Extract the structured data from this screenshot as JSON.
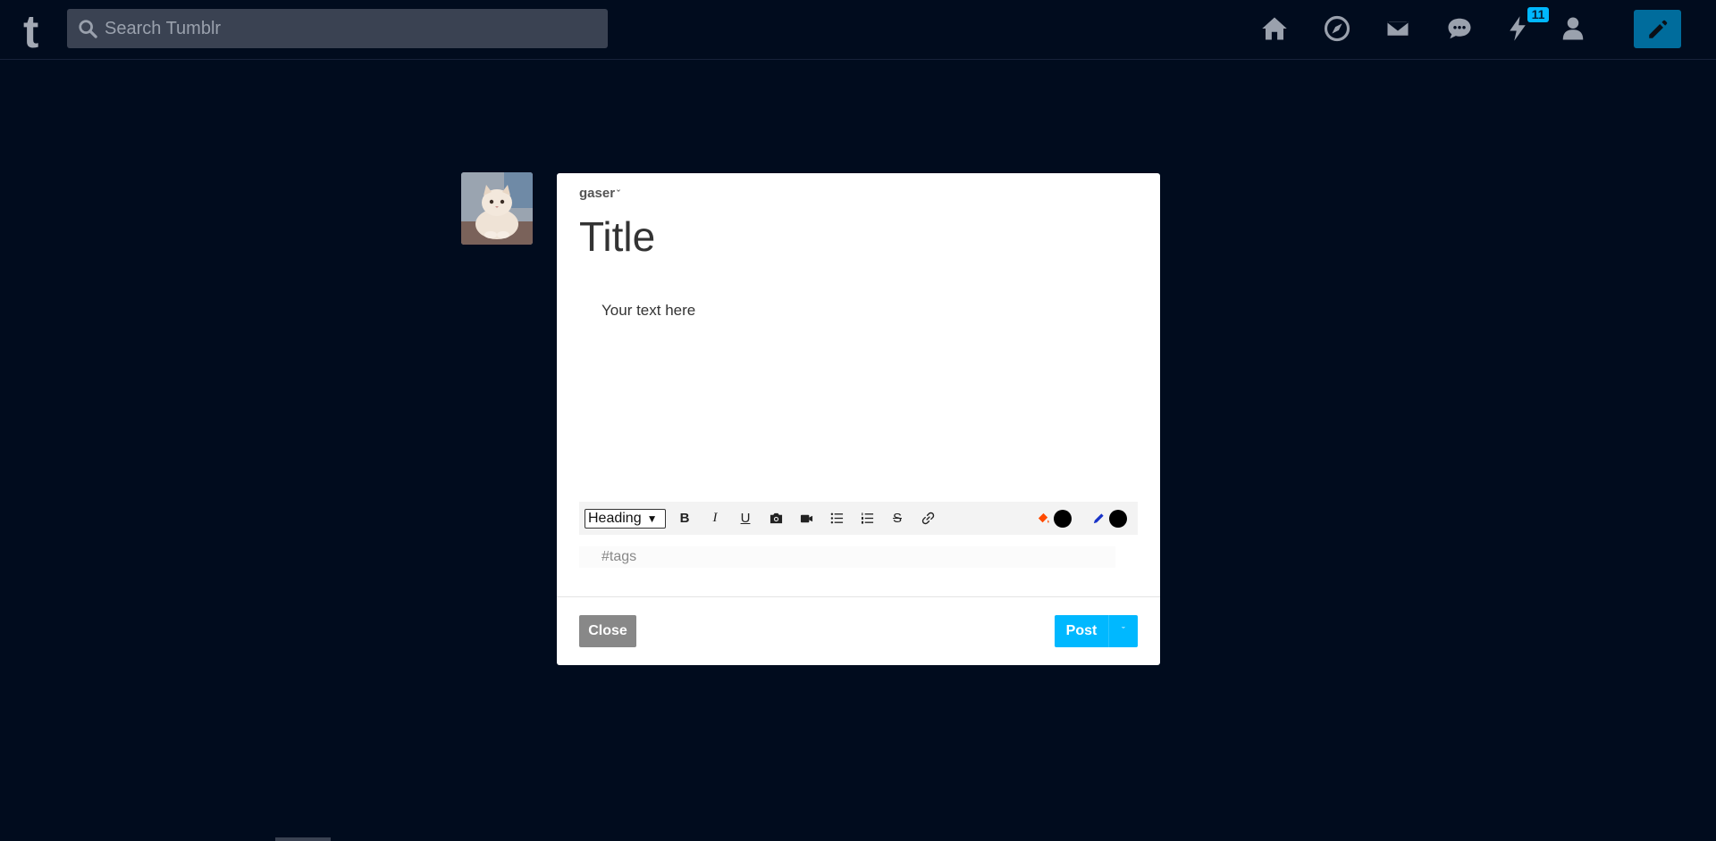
{
  "topbar": {
    "logo": "t",
    "search_placeholder": "Search Tumblr",
    "icons": [
      "home-icon",
      "explore-icon",
      "inbox-icon",
      "messages-icon",
      "activity-icon",
      "account-icon",
      "compose-icon"
    ],
    "activity_badge": "11",
    "accent": "#00b8ff"
  },
  "avatar": {
    "alt": "cat avatar"
  },
  "editor": {
    "blog_name": "gaser",
    "blog_caret": "ˇ",
    "title_placeholder": "Title",
    "body_placeholder": "Your text here",
    "toolbar": {
      "format_select": "Heading",
      "bold": "B",
      "italic": "I",
      "underline": "U",
      "strikethrough": "S"
    },
    "tags_placeholder": "#tags",
    "close_label": "Close",
    "post_label": "Post",
    "post_caret": "ˇ"
  },
  "colors": {
    "background": "#010c1e",
    "post_button": "#00b8ff",
    "close_button": "#888888",
    "compose_button": "#006c9c"
  }
}
